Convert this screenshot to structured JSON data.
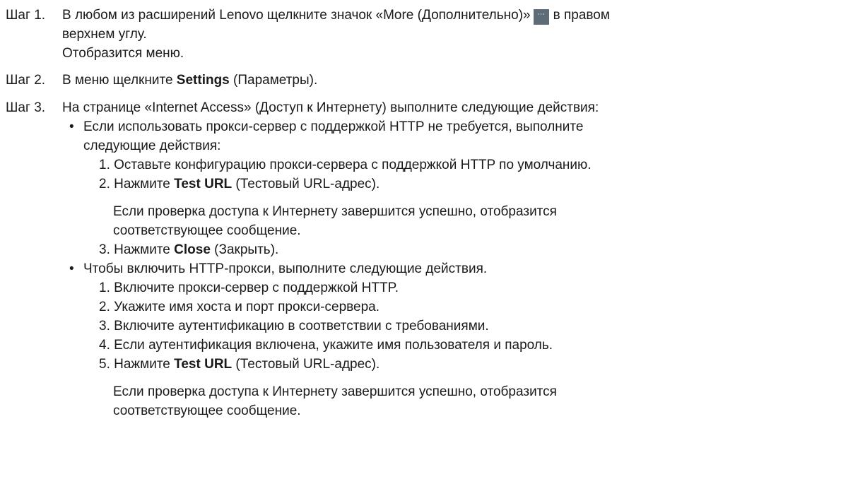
{
  "steps": [
    {
      "label": "Шаг 1.",
      "line1_before_icon": "В любом из расширений Lenovo щелкните значок «More (Дополнительно)»",
      "line1_after_icon": "в правом",
      "line2": "верхнем углу.",
      "line3": "Отобразится меню."
    },
    {
      "label": "Шаг 2.",
      "text_before": "В меню щелкните ",
      "bold": "Settings",
      "text_after": " (Параметры)."
    },
    {
      "label": "Шаг 3.",
      "text": "На странице «Internet Access» (Доступ к Интернету) выполните следующие действия:",
      "bullets": [
        {
          "line1": "Если использовать прокси-сервер с поддержкой HTTP не требуется, выполните",
          "line2": "следующие действия:",
          "items": [
            {
              "num": "1.",
              "text": "Оставьте конфигурацию прокси-сервера с поддержкой HTTP по умолчанию."
            },
            {
              "num": "2.",
              "text_before": "Нажмите ",
              "bold": "Test URL",
              "text_after": " (Тестовый URL-адрес)."
            },
            {
              "num": "3.",
              "text_before": "Нажмите ",
              "bold": "Close",
              "text_after": " (Закрыть)."
            }
          ],
          "note_line1": "Если проверка доступа к Интернету завершится успешно, отобразится",
          "note_line2": "соответствующее сообщение."
        },
        {
          "line1": "Чтобы включить HTTP-прокси, выполните следующие действия.",
          "items": [
            {
              "num": "1.",
              "text": "Включите прокси-сервер с поддержкой HTTP."
            },
            {
              "num": "2.",
              "text": "Укажите имя хоста и порт прокси-сервера."
            },
            {
              "num": "3.",
              "text": "Включите аутентификацию в соответствии с требованиями."
            },
            {
              "num": "4.",
              "text": "Если аутентификация включена, укажите имя пользователя и пароль."
            },
            {
              "num": "5.",
              "text_before": "Нажмите ",
              "bold": "Test URL",
              "text_after": " (Тестовый URL-адрес)."
            }
          ],
          "note_line1": "Если проверка доступа к Интернету завершится успешно, отобразится",
          "note_line2": "соответствующее сообщение."
        }
      ]
    }
  ],
  "icon": {
    "name": "more-icon",
    "glyph": "···",
    "background": "#5e6b78"
  }
}
